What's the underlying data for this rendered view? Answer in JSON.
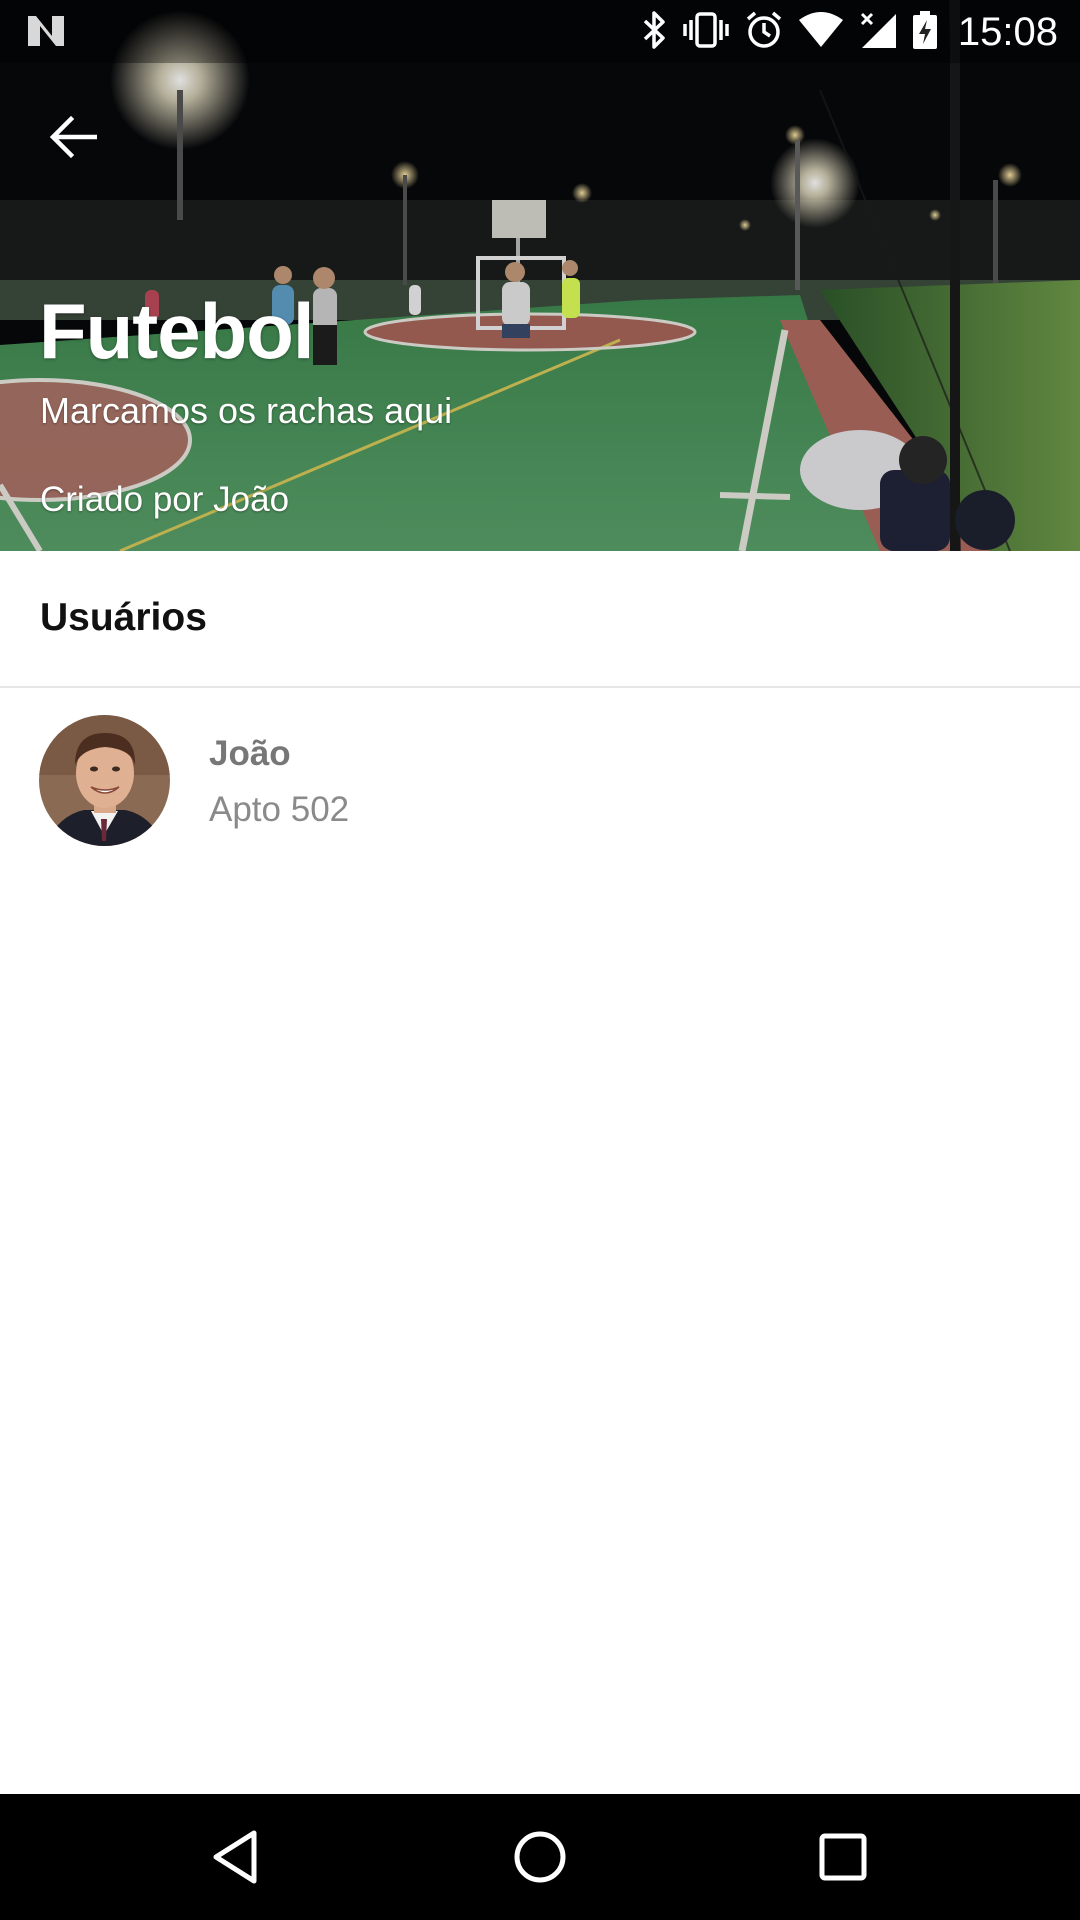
{
  "status_bar": {
    "time": "15:08",
    "icons": [
      "notification-n-icon",
      "bluetooth-icon",
      "vibrate-icon",
      "alarm-icon",
      "wifi-icon",
      "signal-icon",
      "battery-charging-icon"
    ]
  },
  "header": {
    "title": "Futebol",
    "subtitle": "Marcamos os rachas aqui",
    "creator": "Criado por João",
    "back_icon": "arrow-back-icon"
  },
  "users_section": {
    "title": "Usuários",
    "users": [
      {
        "name": "João",
        "detail": "Apto 502"
      }
    ]
  },
  "nav_bar": {
    "icons": [
      "back-triangle-icon",
      "home-circle-icon",
      "recents-square-icon"
    ]
  },
  "colors": {
    "court_green": "#4f9a5f",
    "court_red": "#b8695e",
    "text_muted": "#777777"
  }
}
